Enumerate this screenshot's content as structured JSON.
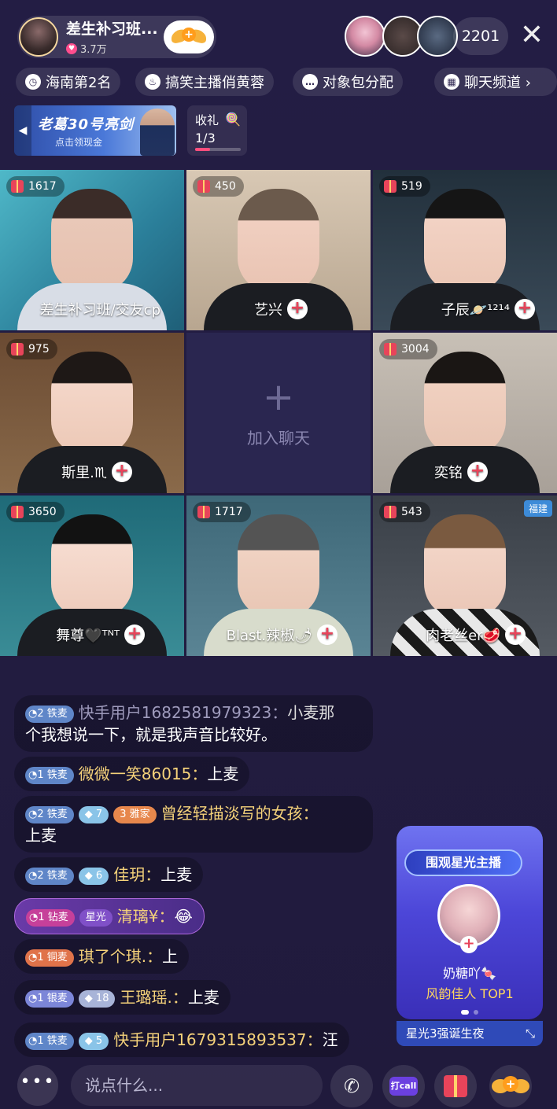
{
  "header": {
    "host_name": "差生补习班...",
    "host_likes": "3.7万",
    "viewer_count": "2201",
    "close_label": "✕"
  },
  "tags": [
    {
      "icon": "clock-icon",
      "label": "海南第2名"
    },
    {
      "icon": "flame-icon",
      "label": "搞笑主播俏黄蓉"
    },
    {
      "icon": "chat-icon",
      "label": "对象包分配"
    },
    {
      "icon": "grid-icon",
      "label": "聊天频道 ›"
    }
  ],
  "promo": {
    "title": "老葛30号亮剑",
    "subtitle": "点击领现金"
  },
  "gift_progress": {
    "label": "收礼",
    "value": "1/3",
    "fraction": 0.333
  },
  "grid": [
    {
      "gifts": "1617",
      "name": "差生补习班/交友cp",
      "has_plus": false
    },
    {
      "gifts": "450",
      "name": "艺兴",
      "has_plus": true
    },
    {
      "gifts": "519",
      "name": "子辰🪐¹²¹⁴",
      "has_plus": true
    },
    {
      "gifts": "975",
      "name": "斯里.♏",
      "has_plus": true
    },
    {
      "empty": true,
      "label": "加入聊天"
    },
    {
      "gifts": "3004",
      "name": "奕铭",
      "has_plus": true
    },
    {
      "gifts": "3650",
      "name": "舞尊🖤ᵀᴺᵀ",
      "has_plus": true
    },
    {
      "gifts": "1717",
      "name": "Blast.辣椒🌶",
      "has_plus": true
    },
    {
      "gifts": "543",
      "name": "肉老丝er🥩",
      "has_plus": true,
      "region": "福建"
    }
  ],
  "chat": [
    {
      "level_num": "2",
      "level_label": "铁麦",
      "user": "快手用户1682581979323：",
      "text": "小麦那",
      "line2": "个我想说一下，就是我声音比较好。"
    },
    {
      "level_num": "1",
      "level_label": "铁麦",
      "user": "微微一笑86015：",
      "text": "上麦"
    },
    {
      "level_num": "2",
      "level_label": "铁麦",
      "gem": "7",
      "yajia_num": "3",
      "yajia_label": "雅家",
      "user": "曾经轻描淡写的女孩：",
      "line2": "上麦"
    },
    {
      "level_num": "2",
      "level_label": "铁麦",
      "gem": "6",
      "user": "佳玥：",
      "text": "上麦"
    },
    {
      "level_num": "1",
      "level_label": "钻麦",
      "star": "星光",
      "user": "清璃¥：",
      "text": "😂"
    },
    {
      "level_num": "1",
      "level_label": "铜麦",
      "user": "琪了个琪.：",
      "text": "上"
    },
    {
      "level_num": "1",
      "level_label": "银麦",
      "gem": "18",
      "user": "王璐瑶.：",
      "text": "上麦"
    },
    {
      "level_num": "1",
      "level_label": "铁麦",
      "gem": "5",
      "user": "快手用户1679315893537：",
      "text": "汪"
    }
  ],
  "star_card": {
    "header": "围观星光主播",
    "name": "奶糖吖🍬",
    "subtitle": "风韵佳人 TOP1",
    "footer": "星光3强诞生夜"
  },
  "bottom": {
    "more": "•••",
    "input_placeholder": "说点什么...",
    "call_label": "打call"
  }
}
